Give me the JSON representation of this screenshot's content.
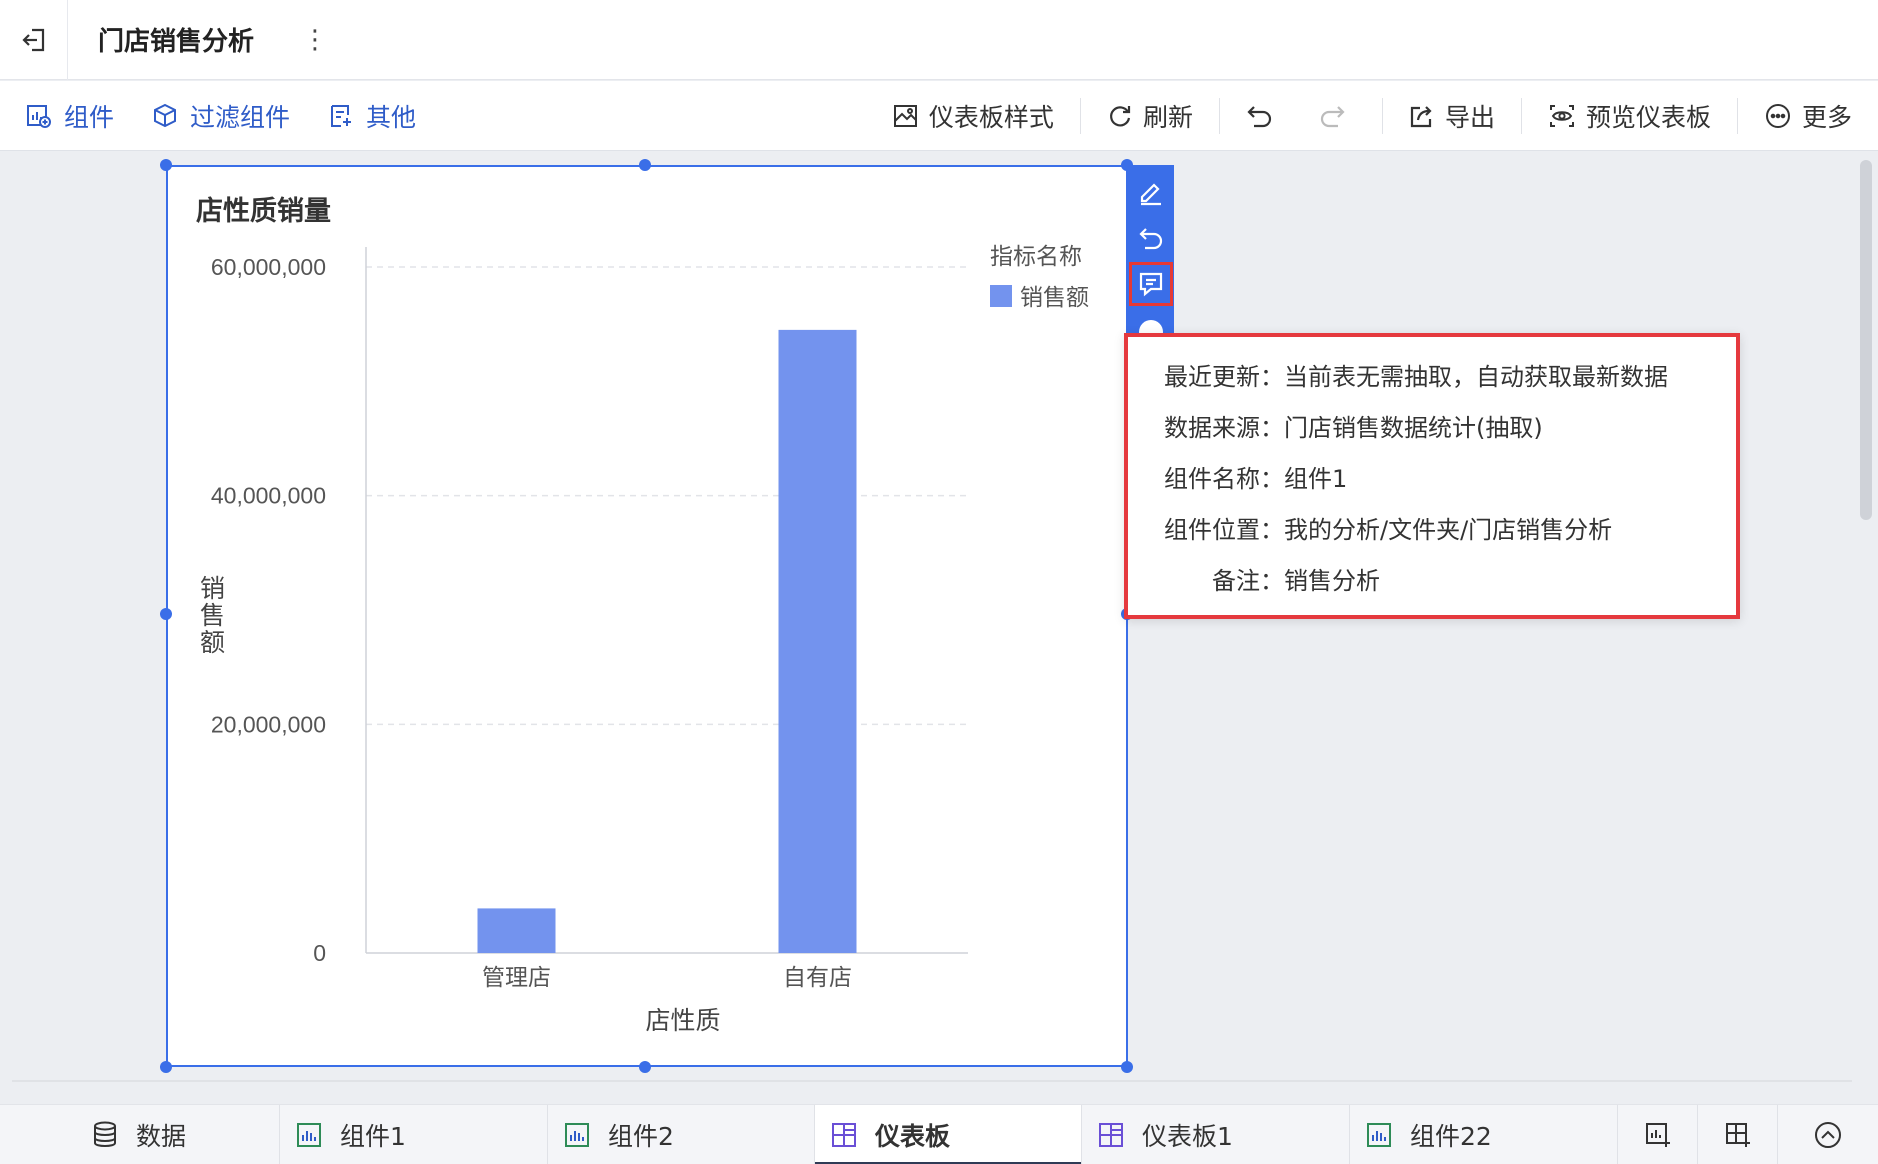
{
  "header": {
    "title": "门店销售分析"
  },
  "toolbar": {
    "left": [
      "组件",
      "过滤组件",
      "其他"
    ],
    "right": {
      "style": "仪表板样式",
      "refresh": "刷新",
      "export": "导出",
      "preview": "预览仪表板",
      "more": "更多"
    }
  },
  "colors": {
    "accent": "#2f5cc8",
    "bar": "#7393ee",
    "highlight": "#e5393e",
    "selection": "#3a6ee8"
  },
  "widget": {
    "title": "店性质销量"
  },
  "chart_data": {
    "type": "bar",
    "title": "店性质销量",
    "xlabel": "店性质",
    "ylabel": "销售额",
    "categories": [
      "管理店",
      "自有店"
    ],
    "series": [
      {
        "name": "销售额",
        "values": [
          3900000,
          54500000
        ]
      }
    ],
    "legend_title": "指标名称",
    "legend_position": "top-right",
    "ylim": [
      0,
      60000000
    ],
    "yticks": [
      0,
      20000000,
      40000000,
      60000000
    ],
    "ytick_labels": [
      "0",
      "20,000,000",
      "40,000,000",
      "60,000,000"
    ],
    "grid": true
  },
  "info_popover": {
    "rows": [
      {
        "label": "最近更新：",
        "value": "当前表无需抽取，自动获取最新数据"
      },
      {
        "label": "数据来源：",
        "value": "门店销售数据统计(抽取)"
      },
      {
        "label": "组件名称：",
        "value": "组件1"
      },
      {
        "label": "组件位置：",
        "value": "我的分析/文件夹/门店销售分析"
      },
      {
        "label": "备注：",
        "value": "销售分析"
      }
    ]
  },
  "bottom_tabs": [
    {
      "label": "数据",
      "icon": "database-icon"
    },
    {
      "label": "组件1",
      "icon": "bar-chart-icon"
    },
    {
      "label": "组件2",
      "icon": "bar-chart-icon"
    },
    {
      "label": "仪表板",
      "icon": "dashboard-icon",
      "active": true
    },
    {
      "label": "仪表板1",
      "icon": "dashboard-icon"
    },
    {
      "label": "组件22",
      "icon": "bar-chart-icon"
    }
  ]
}
